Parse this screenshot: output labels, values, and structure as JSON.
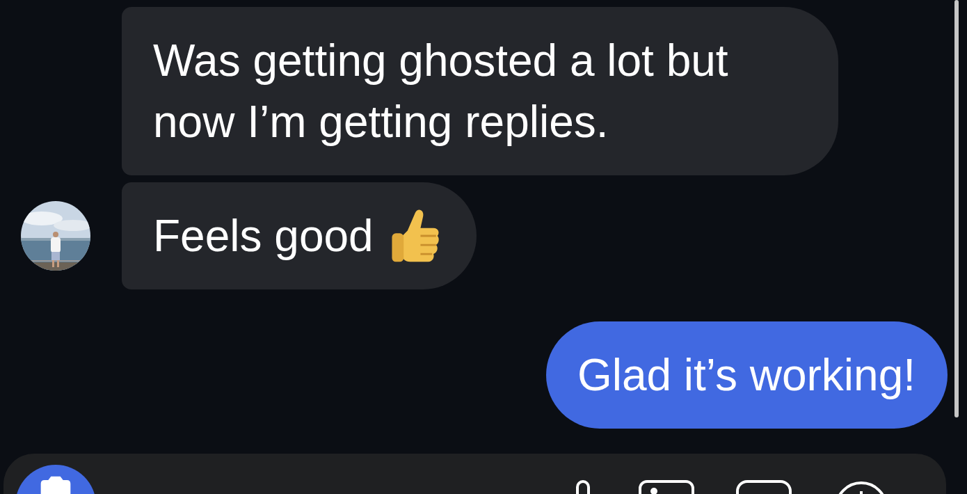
{
  "messages": [
    {
      "text": "Was getting ghosted a lot but now I’m getting replies.",
      "outgoing": false,
      "avatar": false,
      "emoji": false
    },
    {
      "text": "Feels good",
      "outgoing": false,
      "avatar": true,
      "emoji": true
    },
    {
      "text": "Glad it’s working!",
      "outgoing": true,
      "avatar": false,
      "emoji": false
    }
  ]
}
